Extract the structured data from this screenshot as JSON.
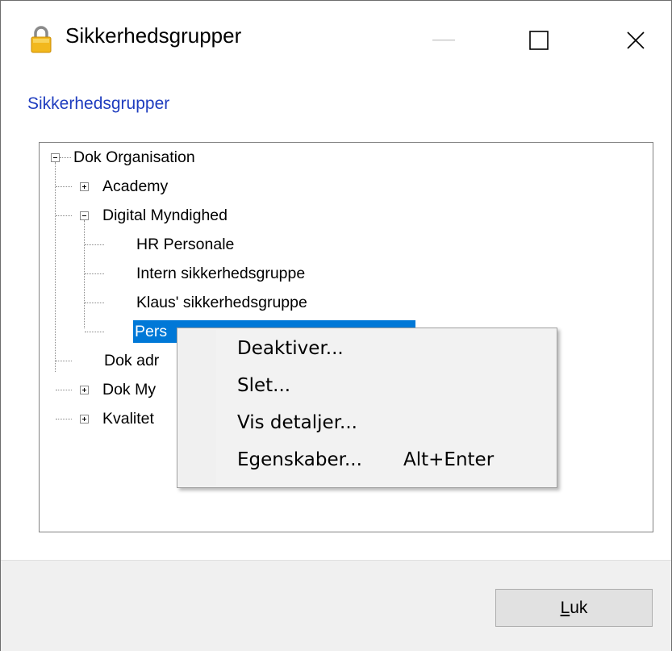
{
  "window": {
    "title": "Sikkerhedsgrupper",
    "heading": "Sikkerhedsgrupper"
  },
  "tree": {
    "root": "Dok Organisation",
    "nodes": [
      {
        "label": "Academy",
        "expander": "plus"
      },
      {
        "label": "Digital Myndighed",
        "expander": "minus"
      },
      {
        "label": "HR Personale"
      },
      {
        "label": "Intern sikkerhedsgruppe"
      },
      {
        "label": "Klaus' sikkerhedsgruppe"
      },
      {
        "label": "Pers",
        "selected": true
      },
      {
        "label": "Dok adr"
      },
      {
        "label": "Dok My",
        "expander": "plus"
      },
      {
        "label": "Kvalitet",
        "expander": "plus"
      }
    ]
  },
  "context_menu": {
    "items": [
      {
        "label": "Deaktiver..."
      },
      {
        "label": "Slet..."
      },
      {
        "label": "Vis detaljer..."
      },
      {
        "label": "Egenskaber...",
        "shortcut": "Alt+Enter"
      }
    ]
  },
  "footer": {
    "close_label_underlined": "L",
    "close_label_rest": "uk"
  },
  "colors": {
    "selection": "#0078d7",
    "heading": "#1f3dbf",
    "footer_bg": "#f0f0f0"
  }
}
